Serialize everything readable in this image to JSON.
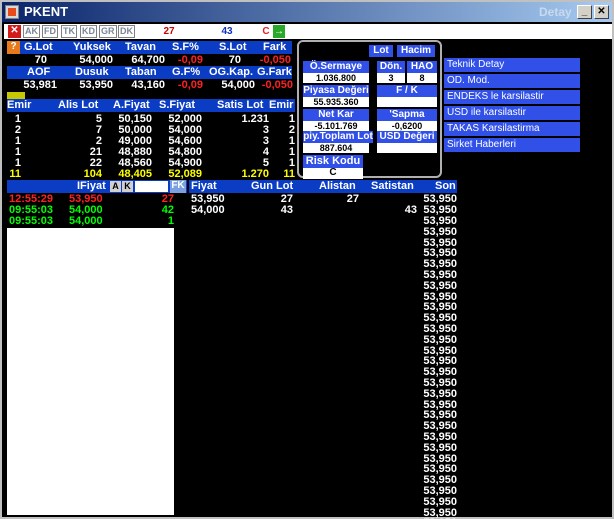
{
  "window": {
    "title": "PKENT",
    "right_label": "Detay",
    "min": "_",
    "max": "□",
    "close": "✕"
  },
  "toolbar": {
    "close_label": "✕",
    "buttons": [
      "AK",
      "FD",
      "TK",
      "KD",
      "GR",
      "DK"
    ],
    "field_a": "27",
    "field_b": "43",
    "c_label": "C",
    "arrow": "→"
  },
  "summary1": {
    "headers": [
      "G.Lot",
      "Yuksek",
      "Tavan",
      "S.F%",
      "S.Lot",
      "Fark"
    ],
    "values": [
      "70",
      "54,000",
      "64,700",
      "-0,09",
      "70",
      "-0,050"
    ]
  },
  "summary2": {
    "headers": [
      "AOF",
      "Dusuk",
      "Taban",
      "G.F%",
      "OG.Kap.",
      "G.Fark"
    ],
    "values": [
      "53,981",
      "53,950",
      "43,160",
      "-0,09",
      "54,000",
      "-0,050"
    ]
  },
  "depth": {
    "headers": [
      "Emir",
      "Alis Lot",
      "A.Fiyat",
      "S.Fiyat",
      "Satis Lot",
      "Emir"
    ],
    "rows": [
      [
        "1",
        "5",
        "50,150",
        "52,000",
        "1.231",
        "1"
      ],
      [
        "2",
        "7",
        "50,000",
        "54,000",
        "3",
        "2"
      ],
      [
        "1",
        "2",
        "49,000",
        "54,600",
        "3",
        "1"
      ],
      [
        "1",
        "21",
        "48,880",
        "54,800",
        "4",
        "1"
      ],
      [
        "1",
        "22",
        "48,560",
        "54,900",
        "5",
        "1"
      ]
    ],
    "totals": [
      "11",
      "104",
      "48,405",
      "52,089",
      "1.270",
      "11"
    ]
  },
  "trades": {
    "header_label": "IFiyat",
    "a_label": "A",
    "k_label": "K",
    "fk_label": "FK",
    "rows": [
      {
        "time": "12:55:29",
        "price": "53,950",
        "lot": "27",
        "color": "red"
      },
      {
        "time": "09:55:03",
        "price": "54,000",
        "lot": "42",
        "color": "green"
      },
      {
        "time": "09:55:03",
        "price": "54,000",
        "lot": "1",
        "color": "green"
      }
    ]
  },
  "fiyat_table": {
    "headers": [
      "Fiyat",
      "Gun Lot",
      "Alistan",
      "Satistan",
      "Son"
    ],
    "rows": [
      [
        "53,950",
        "27",
        "27",
        "",
        "53,950"
      ],
      [
        "54,000",
        "43",
        "",
        "43",
        "53,950"
      ]
    ],
    "son_repeat_value": "53,950",
    "son_repeat_count": 29
  },
  "panel": {
    "lot_label": "Lot",
    "hacim_label": "Hacim",
    "osermaye_label": "Ö.Sermaye",
    "osermaye_value": "1.036.800",
    "don_label": "Dön.",
    "don_value": "3",
    "hao_label": "HAO",
    "hao_value": "8",
    "piyasa_label": "Piyasa Değeri",
    "piyasa_value": "55.935.360",
    "fk_label": "F / K",
    "fk_value": "",
    "netkar_label": "Net Kar",
    "netkar_value": "-5.101.769",
    "sapma_label": "'Sapma",
    "sapma_value": "-0,6200",
    "piy_label": "piy.Toplam Lot",
    "piy_value": "887.604",
    "usd_label": "USD Değeri",
    "usd_value": "",
    "risk_label": "Risk Kodu",
    "risk_value": "C"
  },
  "links": [
    "Teknik Detay",
    "OD. Mod.",
    "ENDEKS le karsilastir",
    "USD ile karsilastir",
    "TAKAS Karsilastirma",
    "Sirket Haberleri"
  ],
  "colors": {
    "header_bg": "#0b3cc4",
    "accent_blue": "#3050e8",
    "price_yellow": "#ffff00",
    "down_red": "#ff2020",
    "up_green": "#00ff00"
  }
}
